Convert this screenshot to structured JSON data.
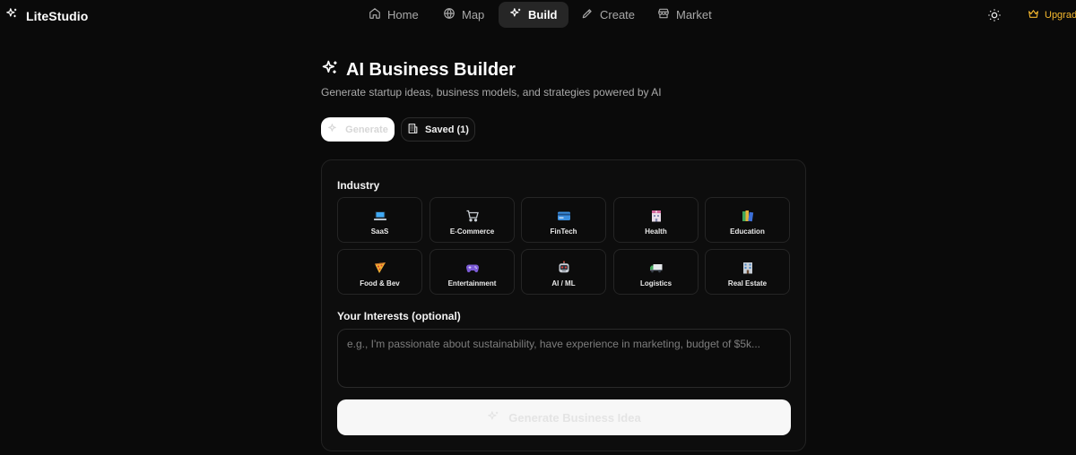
{
  "app": {
    "brand": "LiteStudio"
  },
  "nav": {
    "items": [
      {
        "label": "Home",
        "icon": "home-icon"
      },
      {
        "label": "Map",
        "icon": "globe-icon"
      },
      {
        "label": "Build",
        "icon": "sparkles-icon",
        "active": true
      },
      {
        "label": "Create",
        "icon": "brush-icon"
      },
      {
        "label": "Market",
        "icon": "store-icon"
      }
    ],
    "upgrade_label": "Upgrad"
  },
  "header": {
    "title": "AI Business Builder",
    "subtitle": "Generate startup ideas, business models, and strategies powered by AI"
  },
  "tabs": {
    "generate_label": "Generate",
    "saved_label": "Saved (1)"
  },
  "form": {
    "industry_label": "Industry",
    "industries": [
      {
        "label": "SaaS",
        "icon": "laptop-icon"
      },
      {
        "label": "E-Commerce",
        "icon": "shopping-cart-icon"
      },
      {
        "label": "FinTech",
        "icon": "credit-card-icon"
      },
      {
        "label": "Health",
        "icon": "hospital-icon"
      },
      {
        "label": "Education",
        "icon": "books-icon"
      },
      {
        "label": "Food & Bev",
        "icon": "pizza-icon"
      },
      {
        "label": "Entertainment",
        "icon": "gamepad-icon"
      },
      {
        "label": "AI / ML",
        "icon": "robot-icon"
      },
      {
        "label": "Logistics",
        "icon": "truck-icon"
      },
      {
        "label": "Real Estate",
        "icon": "building-icon"
      }
    ],
    "interests_label": "Your Interests (optional)",
    "interests_placeholder": "e.g., I'm passionate about sustainability, have experience in marketing, budget of $5k...",
    "interests_value": "",
    "generate_button_label": "Generate Business Idea"
  },
  "colors": {
    "background": "#0a0a0a",
    "accent_upgrade": "#f5b82e",
    "active_nav": "#262626"
  }
}
